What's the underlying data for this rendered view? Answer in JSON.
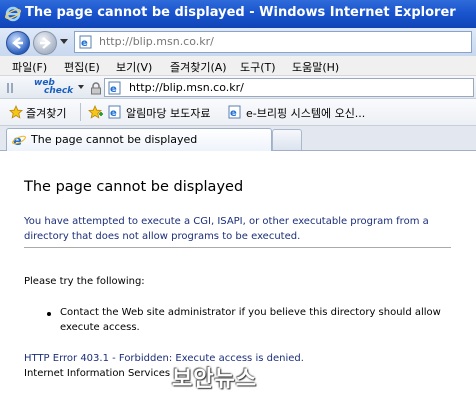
{
  "window": {
    "title": "The page cannot be displayed - Windows Internet Explorer"
  },
  "address_bar": {
    "url": "http://blip.msn.co.kr/"
  },
  "menu": {
    "items": [
      "파일(F)",
      "편집(E)",
      "보기(V)",
      "즐겨찾기(A)",
      "도구(T)",
      "도움말(H)"
    ]
  },
  "toolbar2": {
    "logo_line1": "web",
    "logo_line2": "check",
    "url": "http://blip.msn.co.kr/"
  },
  "favorites_bar": {
    "favorites_label": "즐겨찾기",
    "links": [
      "알림마당 보도자료",
      "e-브리핑 시스템에 오신..."
    ]
  },
  "tabs": {
    "active_label": "The page cannot be displayed"
  },
  "page": {
    "heading": "The page cannot be displayed",
    "para1_line1": "You have attempted to execute a CGI, ISAPI, or other executable program from a",
    "para1_line2": "directory that does not allow programs to be executed.",
    "try_label": "Please try the following:",
    "bullet_line1": "Contact the Web site administrator if you believe this directory should allow",
    "bullet_line2": "execute access.",
    "error_line": "HTTP Error 403.1 - Forbidden: Execute access is denied.",
    "iis_line": "Internet Information Services"
  },
  "watermark": {
    "text": "보안뉴스"
  }
}
